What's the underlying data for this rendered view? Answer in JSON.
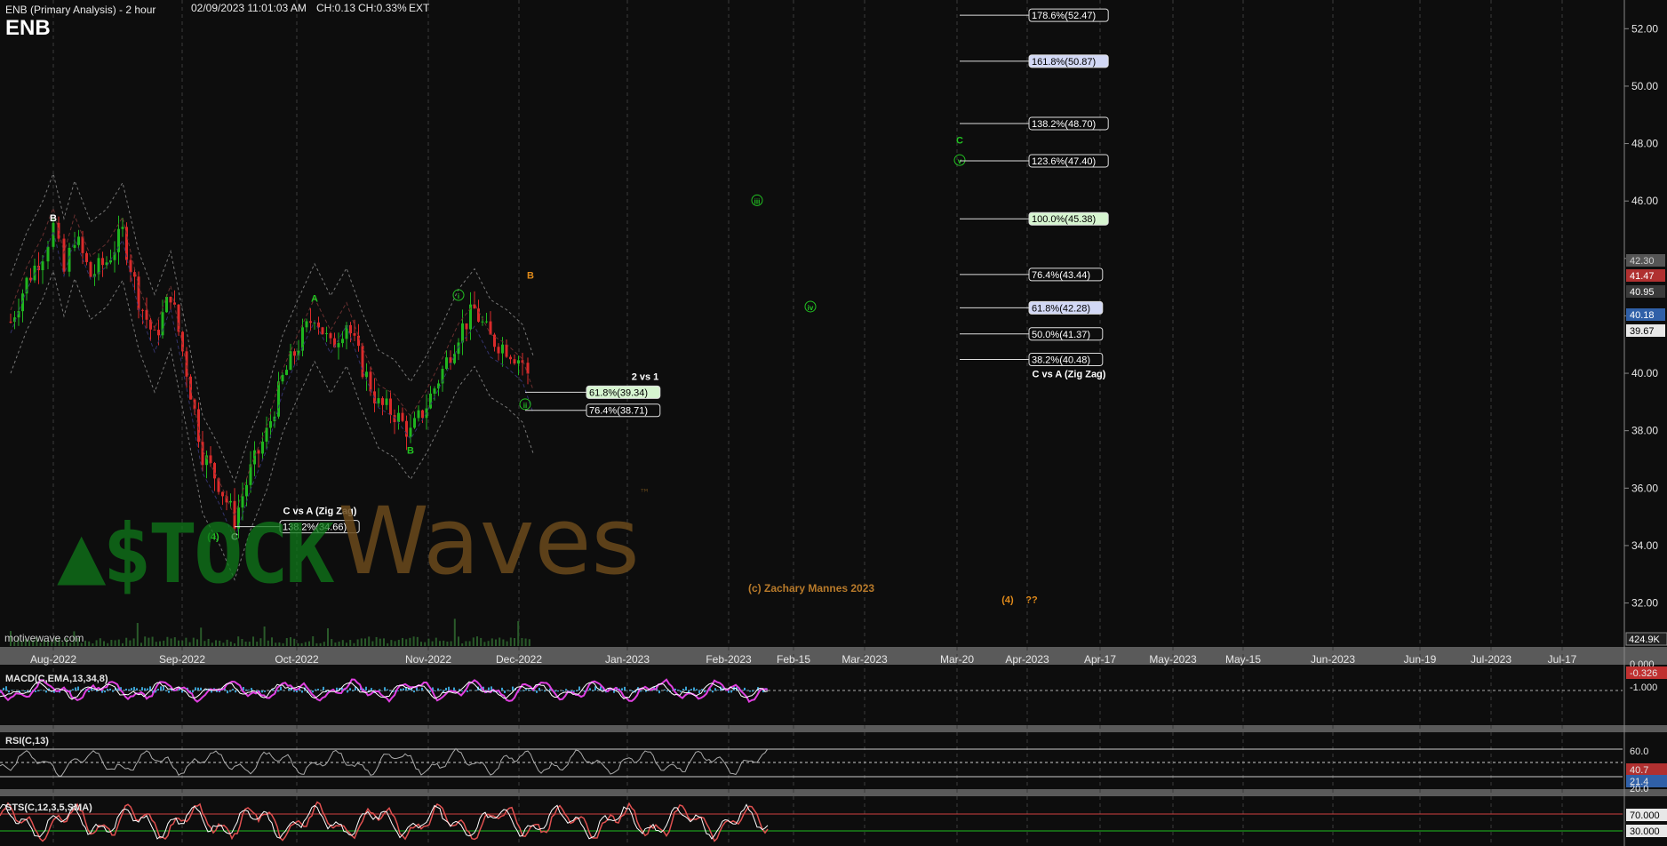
{
  "header": {
    "title": "ENB (Primary Analysis) - 2 hour",
    "symbol": "ENB",
    "datetime": "02/09/2023 11:01:03 AM",
    "change": "CH:0.13",
    "change_pct": "CH:0.33%",
    "session": "EXT"
  },
  "watermark": {
    "stock": "$TOCK",
    "waves": "Waves",
    "tm": "™",
    "copyright": "(c) Zachary Mannes 2023",
    "source": "motivewave.com"
  },
  "colors": {
    "background": "#0d0d0d",
    "grid": "#3a3a3a",
    "up_candle": "#1fb51f",
    "down_candle": "#d92a2a",
    "wave_green": "#22c322",
    "wave_orange": "#e08a1a",
    "macd_line": "#e040e0",
    "macd_hist": "#3aa0d0"
  },
  "chart_data": {
    "type": "candlestick",
    "interval": "2 hour",
    "ylim": [
      30.5,
      53
    ],
    "y_ticks": [
      "52.00",
      "50.00",
      "48.00",
      "46.00",
      "44.00",
      "42.00",
      "40.00",
      "38.00",
      "36.00",
      "34.00",
      "32.00"
    ],
    "x_ticks": [
      "Aug-2022",
      "Sep-2022",
      "Oct-2022",
      "Nov-2022",
      "Dec-2022",
      "Jan-2023",
      "Feb-2023",
      "Feb-15",
      "Mar-2023",
      "Mar-20",
      "Apr-2023",
      "Apr-17",
      "May-2023",
      "May-15",
      "Jun-2023",
      "Jun-19",
      "Jul-2023",
      "Jul-17"
    ],
    "price_path": [
      [
        0,
        41.8
      ],
      [
        3,
        43.2
      ],
      [
        6,
        44.2
      ],
      [
        8,
        45.1
      ],
      [
        10,
        43.5
      ],
      [
        12,
        44.8
      ],
      [
        15,
        43.4
      ],
      [
        18,
        43.9
      ],
      [
        21,
        44.9
      ],
      [
        24,
        42.6
      ],
      [
        27,
        41.2
      ],
      [
        30,
        42.8
      ],
      [
        33,
        40.1
      ],
      [
        36,
        37.2
      ],
      [
        39,
        36.2
      ],
      [
        42,
        34.9
      ],
      [
        45,
        36.6
      ],
      [
        48,
        37.9
      ],
      [
        51,
        39.8
      ],
      [
        54,
        41.0
      ],
      [
        57,
        42.1
      ],
      [
        60,
        40.9
      ],
      [
        63,
        41.8
      ],
      [
        66,
        40.2
      ],
      [
        69,
        38.9
      ],
      [
        72,
        38.6
      ],
      [
        75,
        37.9
      ],
      [
        78,
        38.9
      ],
      [
        81,
        40.1
      ],
      [
        84,
        41.4
      ],
      [
        87,
        42.2
      ],
      [
        90,
        41.2
      ],
      [
        93,
        40.9
      ],
      [
        96,
        40.4
      ],
      [
        98,
        39.3
      ]
    ],
    "last_price": "39.67",
    "price_tags": [
      {
        "value": "42.30",
        "color": "#d0d0d0",
        "bg": "#555555"
      },
      {
        "value": "41.47",
        "color": "#ffffff",
        "bg": "#b03030"
      },
      {
        "value": "40.95",
        "color": "#ffffff",
        "bg": "#3a3a3a"
      },
      {
        "value": "40.18",
        "color": "#ffffff",
        "bg": "#3060a8"
      },
      {
        "value": "39.67",
        "color": "#000000",
        "bg": "#e8e8e8"
      }
    ],
    "volume_tag": "424.9K",
    "wave_labels": [
      {
        "text": "B",
        "x": 8,
        "y": 45.3,
        "color": "#ffffff"
      },
      {
        "text": "A",
        "x": 57,
        "y": 42.5,
        "color": "#22c322"
      },
      {
        "text": "(4)",
        "x": 38,
        "y": 34.2,
        "color": "#22c322"
      },
      {
        "text": "C",
        "x": 42,
        "y": 34.2,
        "color": "#ffffff"
      },
      {
        "text": "B",
        "x": 75,
        "y": 37.2,
        "color": "#22c322"
      },
      {
        "text": "i",
        "x": 84,
        "y": 42.6,
        "color": "#22c322",
        "circled": true
      },
      {
        "text": "ii",
        "x": 96.5,
        "y": 38.8,
        "color": "#22c322",
        "circled": true
      },
      {
        "text": "B",
        "x": 97.5,
        "y": 43.3,
        "color": "#e08a1a"
      },
      {
        "text": "iii",
        "x": 140,
        "y": 45.9,
        "color": "#22c322",
        "circled": true
      },
      {
        "text": "iv",
        "x": 150,
        "y": 42.2,
        "color": "#22c322",
        "circled": true
      },
      {
        "text": "C",
        "x": 178,
        "y": 48,
        "color": "#22c322"
      },
      {
        "text": "v",
        "x": 178,
        "y": 47.3,
        "color": "#22c322",
        "circled": true
      },
      {
        "text": "(4)",
        "x": 187,
        "y": 32.0,
        "color": "#e08a1a"
      },
      {
        "text": "??",
        "x": 191.5,
        "y": 32.0,
        "color": "#e08a1a"
      }
    ],
    "fib_sets": [
      {
        "title": "C vs A (Zig Zag)",
        "x0": 42,
        "x1": 50.5,
        "levels": [
          {
            "label": "138.2%(34.66)",
            "value": 34.66
          }
        ]
      },
      {
        "title": "2 vs 1",
        "x0": 96.5,
        "x1": 108,
        "levels": [
          {
            "label": "61.8%(39.34)",
            "value": 39.34,
            "hl": "green"
          },
          {
            "label": "76.4%(38.71)",
            "value": 38.71
          }
        ]
      },
      {
        "title": "C vs A (Zig Zag)",
        "x0": 178,
        "x1": 191,
        "levels": [
          {
            "label": "178.6%(52.47)",
            "value": 52.47
          },
          {
            "label": "161.8%(50.87)",
            "value": 50.87,
            "hl": "blue"
          },
          {
            "label": "138.2%(48.70)",
            "value": 48.7
          },
          {
            "label": "123.6%(47.40)",
            "value": 47.4
          },
          {
            "label": "100.0%(45.38)",
            "value": 45.38,
            "hl": "green"
          },
          {
            "label": "76.4%(43.44)",
            "value": 43.44
          },
          {
            "label": "61.8%(42.28)",
            "value": 42.28,
            "hl": "blue"
          },
          {
            "label": "50.0%(41.37)",
            "value": 41.37
          },
          {
            "label": "38.2%(40.48)",
            "value": 40.48
          }
        ]
      }
    ]
  },
  "indicators": [
    {
      "name": "MACD(C,EMA,13,34,8)",
      "y_ticks": [
        "0.000",
        "-0.326",
        "-1.000"
      ]
    },
    {
      "name": "RSI(C,13)",
      "y_ticks": [
        "60.0",
        "40.7",
        "21.4",
        "20.0"
      ]
    },
    {
      "name": "STS(C,12,3,5,SMA)",
      "y_ticks": [
        "70.000",
        "30.000"
      ]
    }
  ]
}
